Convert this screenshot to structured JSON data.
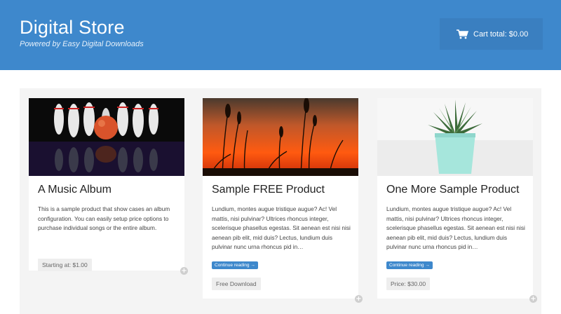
{
  "header": {
    "title": "Digital Store",
    "tagline": "Powered by Easy Digital Downloads",
    "cart_icon": "shopping-cart-icon",
    "cart_label": "Cart total: $0.00"
  },
  "colors": {
    "header_bg": "#3e88cc",
    "cart_bg": "#3a7fc0",
    "button_bg": "#3e88cc",
    "content_bg": "#f4f4f4"
  },
  "products": [
    {
      "title": "A Music Album",
      "description": "This is a sample product that show cases an album configuration. You can easily setup price options to purchase individual songs or the entire album.",
      "price": "Starting at: $1.00",
      "image": "bowling-pins-image"
    },
    {
      "title": "Sample FREE Product",
      "description": "Lundium, montes augue tristique augue? Ac! Vel mattis, nisi pulvinar? Ultrices rhoncus integer, scelerisque phasellus egestas. Sit aenean est nisi nisi aenean pib elit, mid duis? Lectus, lundium duis pulvinar nunc urna rhoncus pid in…",
      "continue_label": "Continue reading →",
      "price": "Free Download",
      "image": "sunset-grass-image"
    },
    {
      "title": "One More Sample Product",
      "description": "Lundium, montes augue tristique augue? Ac! Vel mattis, nisi pulvinar? Ultrices rhoncus integer, scelerisque phasellus egestas. Sit aenean est nisi nisi aenean pib elit, mid duis? Lectus, lundium duis pulvinar nunc urna rhoncus pid in…",
      "continue_label": "Continue reading →",
      "price": "Price: $30.00",
      "image": "succulent-plant-image"
    }
  ]
}
